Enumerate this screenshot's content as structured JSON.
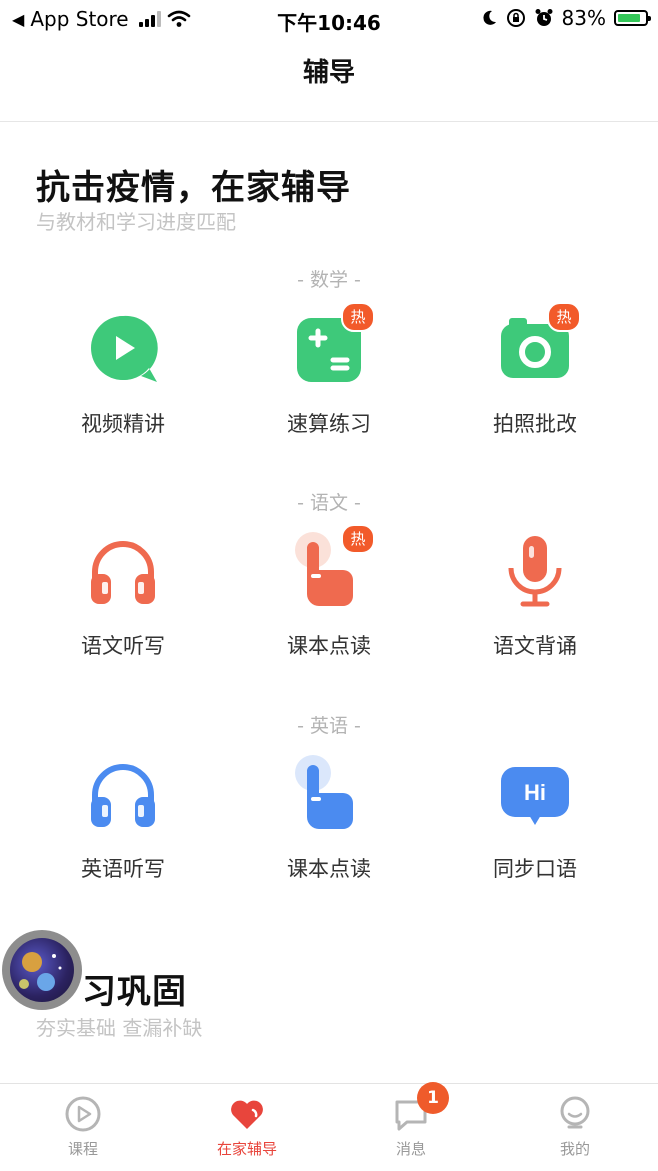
{
  "status_bar": {
    "back_app": "App Store",
    "time": "下午10:46",
    "battery": "83%"
  },
  "nav": {
    "title": "辅导"
  },
  "section1": {
    "title": "抗击疫情，在家辅导",
    "subtitle": "与教材和学习进度匹配"
  },
  "groups": {
    "math": "- 数学 -",
    "chinese": "- 语文 -",
    "english": "- 英语 -"
  },
  "tiles": {
    "video_lecture": "视频精讲",
    "quick_calc": "速算练习",
    "photo_check": "拍照批改",
    "chinese_dictation": "语文听写",
    "chinese_reading": "课本点读",
    "chinese_recite": "语文背诵",
    "english_dictation": "英语听写",
    "english_reading": "课本点读",
    "oral_english": "同步口语"
  },
  "hot_badge": "热",
  "hi_text": "Hi",
  "section2": {
    "title": "习巩固",
    "subtitle": "夯实基础 查漏补缺"
  },
  "tabbar": {
    "courses": "课程",
    "home_tutor": "在家辅导",
    "messages": "消息",
    "messages_badge": "1",
    "mine": "我的"
  },
  "colors": {
    "accent_red": "#e8453c",
    "math_green": "#3ec97a",
    "chinese_red": "#ef6a4f",
    "english_blue": "#4b8bf0",
    "hot_orange": "#f25a2a"
  }
}
